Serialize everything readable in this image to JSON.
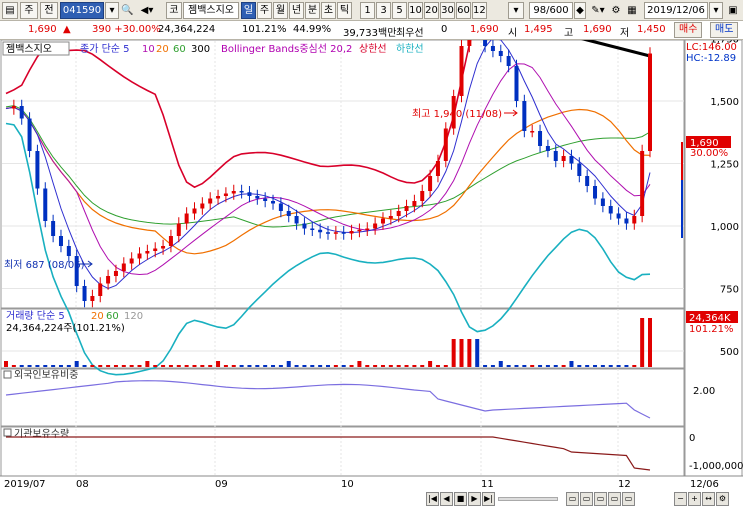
{
  "toolbar": {
    "mode": "주",
    "mode2": "전",
    "code": "041590",
    "tag": "코",
    "name": "젬백스지오",
    "periods": [
      "일",
      "주",
      "월",
      "년",
      "분",
      "초",
      "틱"
    ],
    "minutes": [
      "1",
      "3",
      "5",
      "10",
      "20",
      "30",
      "60",
      "120"
    ],
    "count": "98/600",
    "date": "2019/12/06"
  },
  "quote": {
    "price": "1,690",
    "change": "390 +30.00%",
    "volume": "24,364,224",
    "vol_pct": "101.21%",
    "turnover": "44.99%",
    "amount": "39,733백만",
    "pref_label": "최우선",
    "pref_value": "0",
    "pref_price": "1,690",
    "open_label": "시",
    "open": "1,495",
    "high_label": "고",
    "high": "1,690",
    "low_label": "저",
    "low": "1,450",
    "buy": "매수",
    "sell": "매도"
  },
  "legend": {
    "name": "젬백스지오",
    "ma": "종가 단순 5",
    "ma_values": [
      "10",
      "20",
      "60",
      "300"
    ],
    "bb": "Bollinger Bands중심선 20,2",
    "upper": "상한선",
    "lower": "하한선"
  },
  "annotations": {
    "high": "최고 1,940 (11/08)",
    "low": "최저 687 (08/06)"
  },
  "price_axis": {
    "ticks": [
      "2,250",
      "2,000",
      "1,750",
      "1,500",
      "1,250",
      "1,000",
      "750",
      "500"
    ],
    "lc": "LC:146.00",
    "hc": "HC:-12.89",
    "current": "1,690",
    "current_pct": "30.00%"
  },
  "volume_panel": {
    "label": "거래량 단순 5",
    "ma_values": [
      "20",
      "60",
      "120"
    ],
    "sub": "24,364,224주(101.21%)",
    "current": "24,364K",
    "current_pct": "101.21%"
  },
  "foreign_panel": {
    "label": "외국인보유비중",
    "tick": "2.00"
  },
  "inst_panel": {
    "label": "기관보유수량",
    "ticks": [
      "0",
      "-1,000,000"
    ]
  },
  "x_axis": {
    "labels": [
      "2019/07",
      "08",
      "09",
      "10",
      "11",
      "12",
      "12/06"
    ]
  },
  "colors": {
    "up": "#e00000",
    "down": "#0030c0",
    "bb_upper": "#d8002a",
    "bb_lower": "#19b0c0",
    "ma300": "#000000",
    "ma5": "#2f2fd0",
    "ma10": "#b010b0",
    "ma20": "#f07000",
    "ma60": "#30a030"
  }
}
